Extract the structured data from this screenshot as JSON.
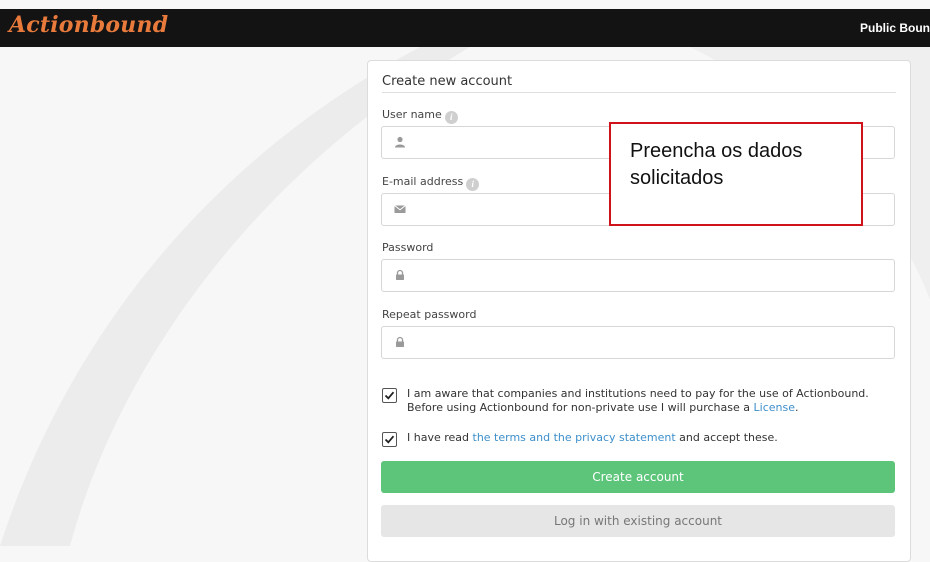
{
  "header": {
    "logo": "Actionbound",
    "nav_link": "Public Boun"
  },
  "form": {
    "title": "Create new account",
    "fields": [
      {
        "label": "User name",
        "icon": "user-icon",
        "value": ""
      },
      {
        "label": "E-mail address",
        "icon": "envelope-icon",
        "value": ""
      },
      {
        "label": "Password",
        "icon": "lock-icon",
        "value": ""
      },
      {
        "label": "Repeat password",
        "icon": "lock-icon",
        "value": ""
      }
    ],
    "consent1": {
      "checked": true,
      "text_line1": "I am aware that companies and institutions need to pay for the use of Actionbound.",
      "text_line2_pre": "Before using Actionbound for non-private use I will purchase a ",
      "link": "License",
      "text_line2_post": "."
    },
    "consent2": {
      "checked": true,
      "pre": "I have read ",
      "link": "the terms and the privacy statement",
      "post": " and accept these."
    },
    "create_button": "Create account",
    "login_button": "Log in with existing account"
  },
  "callout": {
    "text": "Preencha os dados solicitados"
  },
  "colors": {
    "header_bg": "#131313",
    "logo": "#e87a3c",
    "primary_button": "#5cc57a",
    "secondary_button": "#e6e6e6",
    "link": "#3d8fcb",
    "callout_border": "#d0121b"
  }
}
